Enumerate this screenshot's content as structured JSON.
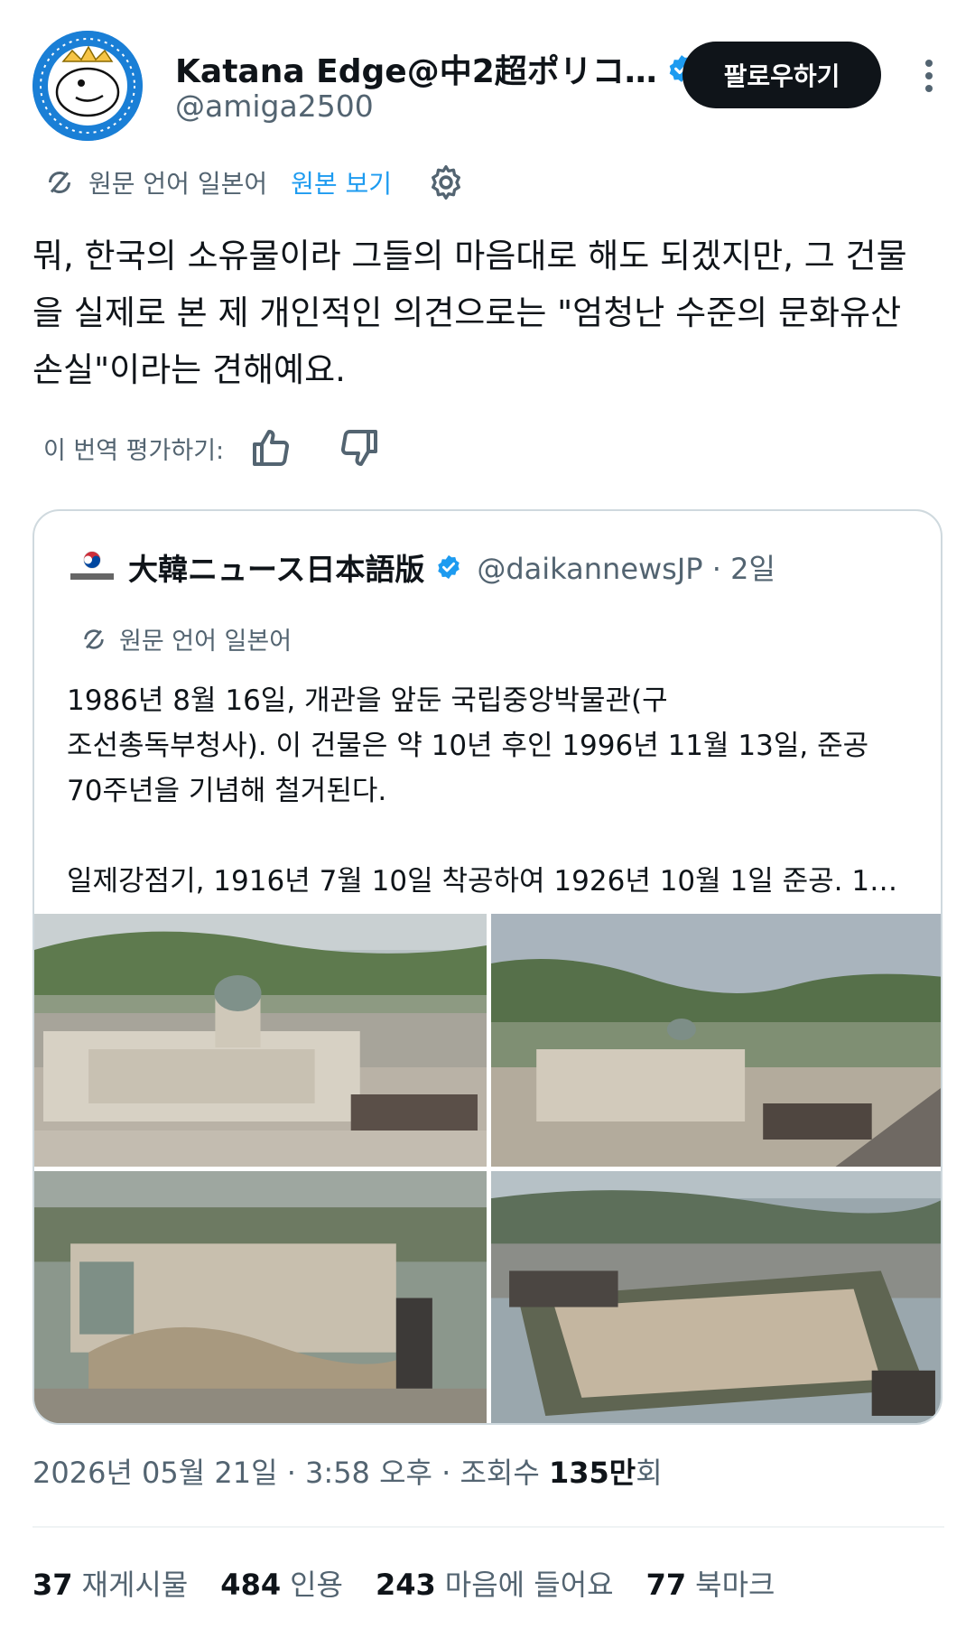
{
  "author": {
    "display_name": "Katana Edge@中2超ポリコ…",
    "handle": "@amiga2500",
    "follow_label": "팔로우하기"
  },
  "translation": {
    "source_label": "원문 언어 일본어",
    "show_original": "원본 보기"
  },
  "tweet": {
    "text": "뭐, 한국의 소유물이라 그들의 마음대로 해도 되겠지만, 그 건물을 실제로 본 제 개인적인 의견으로는 \"엄청난 수준의 문화유산 손실\"이라는 견해예요."
  },
  "rating": {
    "label": "이 번역 평가하기:"
  },
  "quote": {
    "display_name": "大韓ニュース日本語版",
    "handle": "@daikannewsJP · 2일",
    "translation_label": "원문 언어 일본어",
    "text": "1986년 8월 16일, 개관을 앞둔 국립중앙박물관(구\n조선총독부청사). 이 건물은 약 10년 후인 1996년 11월 13일, 준공\n70주년을 기념해 철거된다.\n\n일제강점기, 1916년 7월 10일 착공하여 1926년 10월 1일 준공. 1…"
  },
  "meta": {
    "date": "2026년 05월 21일 · 3:58 오후 · 조회수 ",
    "views": "135만",
    "views_suffix": "회"
  },
  "stats": [
    {
      "count": "37",
      "label": "재게시물"
    },
    {
      "count": "484",
      "label": "인용"
    },
    {
      "count": "243",
      "label": "마음에 들어요"
    },
    {
      "count": "77",
      "label": "북마크"
    }
  ],
  "colors": {
    "text": "#0f1419",
    "secondary": "#536471",
    "link": "#1d9bf0",
    "verified": "#1d9bf0",
    "border": "#cfd9de"
  }
}
